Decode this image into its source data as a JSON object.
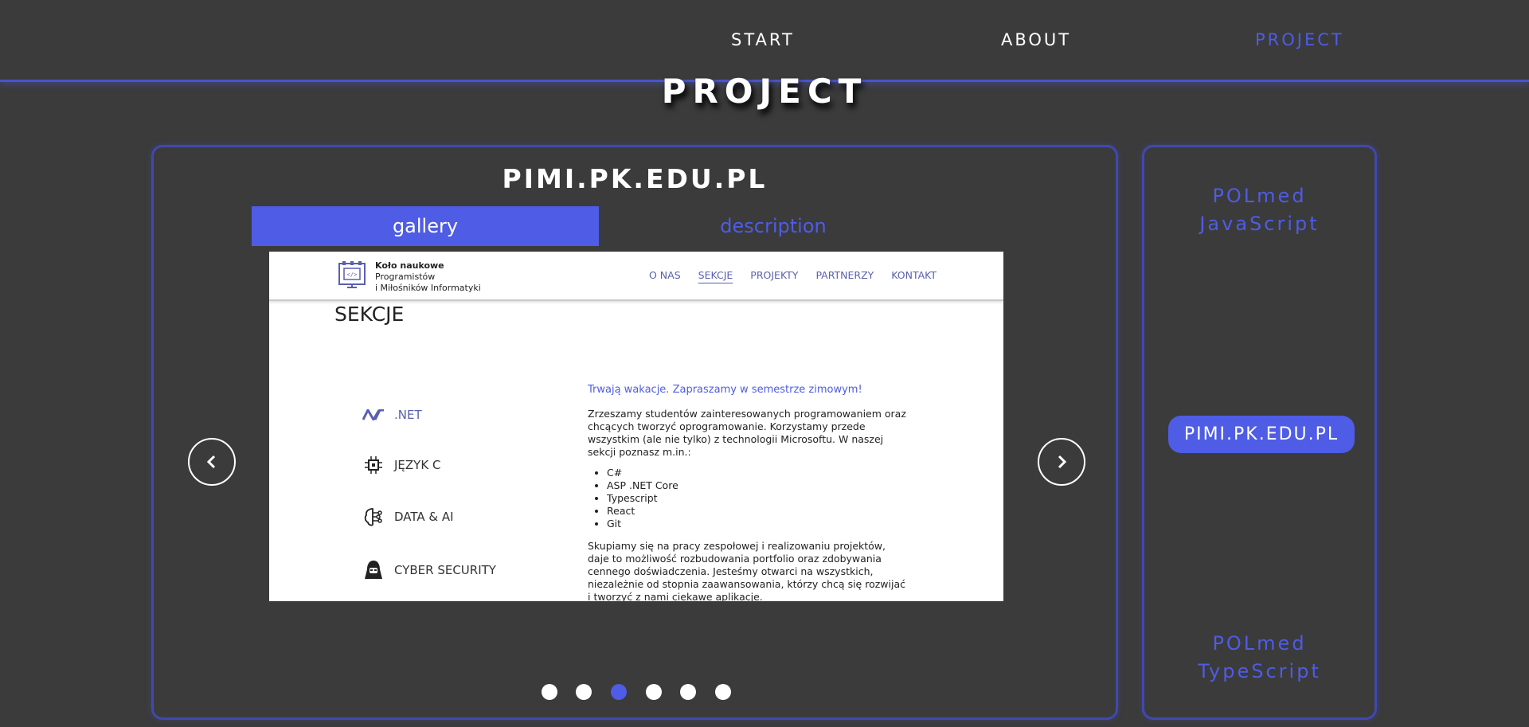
{
  "nav": {
    "items": [
      {
        "label": "START"
      },
      {
        "label": "ABOUT"
      },
      {
        "label": "PROJECT",
        "active": true
      }
    ]
  },
  "page_title": "PROJECT",
  "project": {
    "name": "PIMI.PK.EDU.PL",
    "tabs": [
      {
        "label": "gallery",
        "active": true
      },
      {
        "label": "description",
        "active": false
      }
    ],
    "gallery": {
      "current_slide": 3,
      "slide_count": 6,
      "screenshot": {
        "brand_line1": "Koło naukowe",
        "brand_line2": "Programistów",
        "brand_line3": "i Miłośników Informatyki",
        "menu": [
          "O NAS",
          "SEKCJE",
          "PROJEKTY",
          "PARTNERZY",
          "KONTAKT"
        ],
        "menu_selected": "SEKCJE",
        "heading": "SEKCJE",
        "sections": [
          {
            "label": ".NET",
            "icon": "dotnet-icon"
          },
          {
            "label": "JĘZYK C",
            "icon": "chip-icon"
          },
          {
            "label": "DATA & AI",
            "icon": "brain-icon"
          },
          {
            "label": "CYBER SECURITY",
            "icon": "hacker-icon"
          }
        ],
        "lead": "Trwają wakacje. Zapraszamy w semestrze zimowym!",
        "para1": "Zrzeszamy studentów zainteresowanych programowaniem oraz chcących tworzyć oprogramowanie. Korzystamy przede wszystkim (ale nie tylko) z technologii Microsoftu. W naszej sekcji poznasz m.in.:",
        "techs": [
          "C#",
          "ASP .NET Core",
          "Typescript",
          "React",
          "Git"
        ],
        "para2": "Skupiamy się na pracy zespołowej i realizowaniu projektów, daje to możliwość rozbudowania portfolio oraz zdobywania cennego doświadczenia. Jesteśmy otwarci na wszystkich, niezależnie od stopnia zaawansowania, którzy chcą się rozwijać i tworzyć z nami ciekawe aplikacje."
      }
    }
  },
  "side": {
    "top": {
      "line1": "POLmed",
      "line2": "JavaScript"
    },
    "current": "PIMI.PK.EDU.PL",
    "bottom": {
      "line1": "POLmed",
      "line2": "TypeScript"
    }
  },
  "colors": {
    "accent": "#4e5ce6",
    "background": "#3b3b3b",
    "border": "#4048b0"
  }
}
